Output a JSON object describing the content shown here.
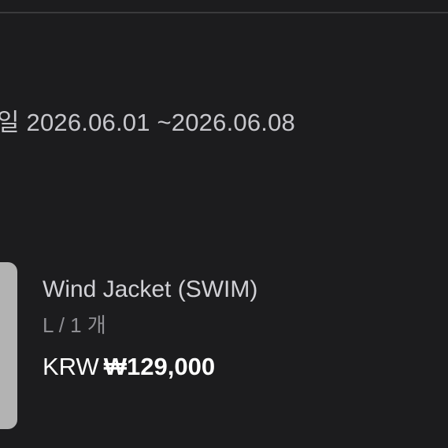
{
  "rental_period": {
    "text": "일 2026.06.01 ~2026.06.08"
  },
  "product": {
    "name": "Wind Jacket (SWIM)",
    "option": "L / 1 개",
    "price_currency": "KRW",
    "price_amount": "₩129,000"
  },
  "colors": {
    "background": "#1c1c1e",
    "divider": "#3a3a3c",
    "thumbnail": "#b3b3b3"
  }
}
